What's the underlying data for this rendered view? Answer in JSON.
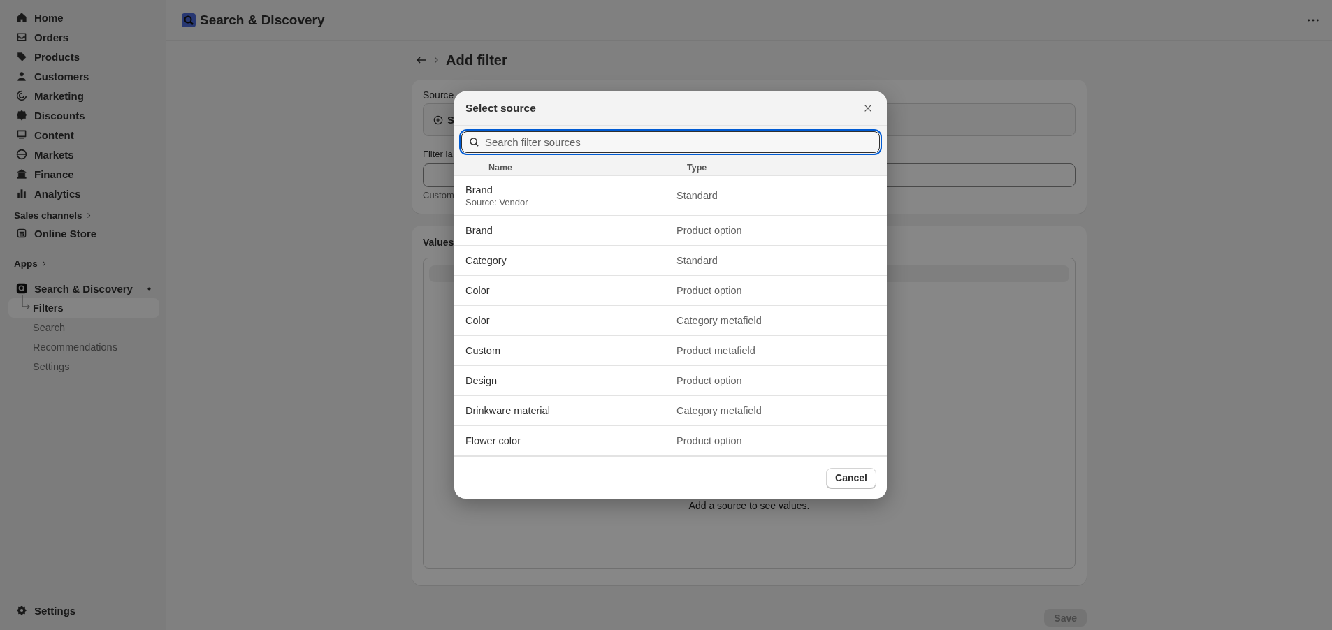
{
  "app_header": {
    "title": "Search & Discovery"
  },
  "sidebar": {
    "items": [
      {
        "label": "Home"
      },
      {
        "label": "Orders"
      },
      {
        "label": "Products"
      },
      {
        "label": "Customers"
      },
      {
        "label": "Marketing"
      },
      {
        "label": "Discounts"
      },
      {
        "label": "Content"
      },
      {
        "label": "Markets"
      },
      {
        "label": "Finance"
      },
      {
        "label": "Analytics"
      }
    ],
    "sales_channels": {
      "label": "Sales channels",
      "items": [
        {
          "label": "Online Store"
        }
      ]
    },
    "apps": {
      "label": "Apps",
      "items": [
        {
          "label": "Search & Discovery",
          "children": [
            {
              "label": "Filters",
              "selected": true
            },
            {
              "label": "Search",
              "selected": false
            },
            {
              "label": "Recommendations",
              "selected": false
            },
            {
              "label": "Settings",
              "selected": false
            }
          ]
        }
      ]
    },
    "footer": {
      "label": "Settings"
    }
  },
  "page": {
    "title": "Add filter",
    "source_card": {
      "label": "Source",
      "button": "S",
      "filter_label": "Filter la",
      "help": "Custom"
    },
    "values_card": {
      "title": "Values",
      "empty": "Add a source to see values."
    },
    "save_button": {
      "label": "Save",
      "disabled": true
    }
  },
  "modal": {
    "title": "Select source",
    "search": {
      "placeholder": "Search filter sources"
    },
    "columns": [
      "Name",
      "Type"
    ],
    "rows": [
      {
        "name": "Brand",
        "source": "Source: Vendor",
        "type": "Standard"
      },
      {
        "name": "Brand",
        "type": "Product option"
      },
      {
        "name": "Category",
        "type": "Standard"
      },
      {
        "name": "Color",
        "type": "Product option"
      },
      {
        "name": "Color",
        "type": "Category metafield"
      },
      {
        "name": "Custom",
        "type": "Product metafield"
      },
      {
        "name": "Design",
        "type": "Product option"
      },
      {
        "name": "Drinkware material",
        "type": "Category metafield"
      },
      {
        "name": "Flower color",
        "type": "Product option"
      }
    ],
    "cancel": "Cancel"
  }
}
